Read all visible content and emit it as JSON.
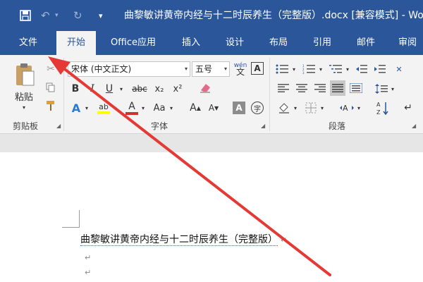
{
  "titlebar": {
    "save_icon": "save-icon",
    "undo_icon": "undo-icon",
    "redo_icon": "redo-icon",
    "title": "曲黎敏讲黄帝内经与十二时辰养生（完整版）.docx [兼容模式] - Wo"
  },
  "tabs": [
    "文件",
    "开始",
    "Office应用",
    "插入",
    "设计",
    "布局",
    "引用",
    "邮件",
    "审阅"
  ],
  "ribbon": {
    "clipboard": {
      "paste": "粘贴",
      "label": "剪贴板"
    },
    "font": {
      "font_name": "宋体 (中文正文)",
      "font_size": "五号",
      "phonetic": "wén",
      "border_char": "A",
      "bold": "B",
      "italic": "I",
      "underline": "U",
      "strike": "abc",
      "subscript": "x₂",
      "superscript": "x²",
      "text_effect": "A",
      "highlight": "ab",
      "font_color": "A",
      "change_case": "Aa",
      "grow": "A",
      "shrink": "A",
      "shade": "A",
      "enclose": "字",
      "label": "字体"
    },
    "paragraph": {
      "label": "段落"
    }
  },
  "document": {
    "line1": "曲黎敏讲黄帝内经与十二时辰养生（完整版）"
  },
  "colors": {
    "accent": "#2b579a",
    "highlight_bar": "#ffff00",
    "font_color_bar": "#d0312d",
    "arrow": "#e53935"
  }
}
